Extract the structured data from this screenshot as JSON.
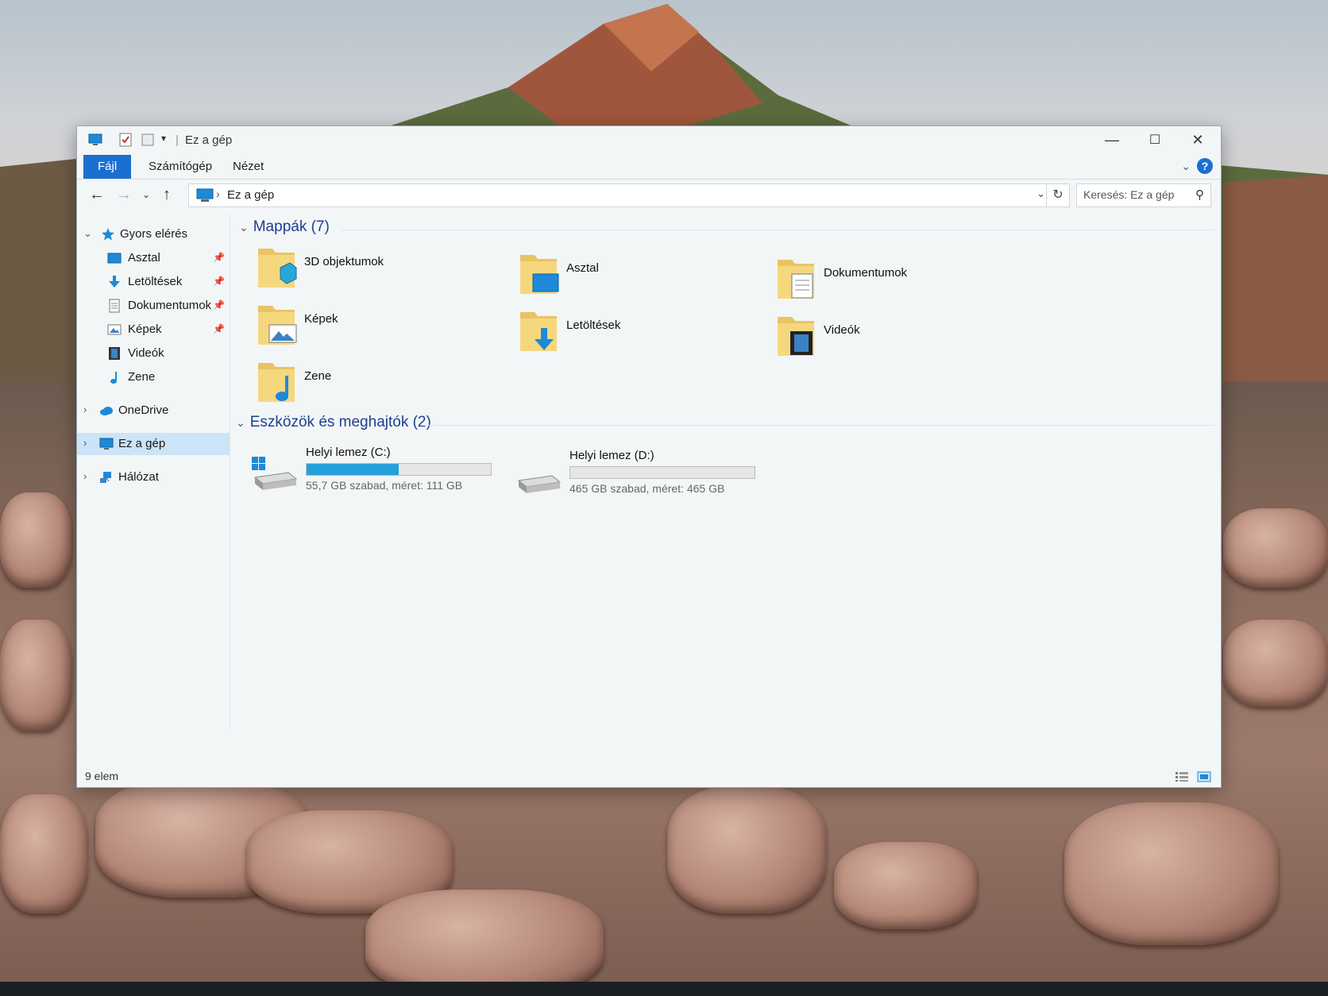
{
  "window": {
    "title": "Ez a gép",
    "controls": {
      "minimize": "—",
      "maximize": "☐",
      "close": "✕"
    }
  },
  "ribbon": {
    "tabs": [
      "Fájl",
      "Számítógép",
      "Nézet"
    ],
    "help": "?"
  },
  "address": {
    "path": "Ez a gép",
    "search_placeholder": "Keresés: Ez a gép"
  },
  "sidebar": {
    "quick_access": "Gyors elérés",
    "pinned": [
      {
        "label": "Asztal",
        "icon": "desktop-icon"
      },
      {
        "label": "Letöltések",
        "icon": "download-icon"
      },
      {
        "label": "Dokumentumok",
        "icon": "document-icon"
      },
      {
        "label": "Képek",
        "icon": "pictures-icon"
      },
      {
        "label": "Videók",
        "icon": "video-icon"
      },
      {
        "label": "Zene",
        "icon": "music-icon"
      }
    ],
    "onedrive": "OneDrive",
    "this_pc": "Ez a gép",
    "network": "Hálózat"
  },
  "folders": {
    "heading": "Mappák (7)",
    "items": [
      {
        "name": "3D objektumok",
        "icon": "3d-objects-folder-icon"
      },
      {
        "name": "Asztal",
        "icon": "desktop-folder-icon"
      },
      {
        "name": "Dokumentumok",
        "icon": "documents-folder-icon"
      },
      {
        "name": "Képek",
        "icon": "pictures-folder-icon"
      },
      {
        "name": "Letöltések",
        "icon": "downloads-folder-icon"
      },
      {
        "name": "Videók",
        "icon": "videos-folder-icon"
      },
      {
        "name": "Zene",
        "icon": "music-folder-icon"
      }
    ]
  },
  "drives": {
    "heading": "Eszközök és meghajtók (2)",
    "items": [
      {
        "name": "Helyi lemez (C:)",
        "info": "55,7 GB szabad, méret: 111 GB",
        "used_fraction": 0.498,
        "system": true
      },
      {
        "name": "Helyi lemez (D:)",
        "info": "465 GB szabad, méret: 465 GB",
        "used_fraction": 0.0,
        "system": false
      }
    ]
  },
  "status": {
    "count": "9 elem"
  },
  "colors": {
    "accent": "#1b6fd1",
    "drive_bar": "#26a0da",
    "group_heading": "#1e3f8f",
    "folder": "#e8c463"
  }
}
